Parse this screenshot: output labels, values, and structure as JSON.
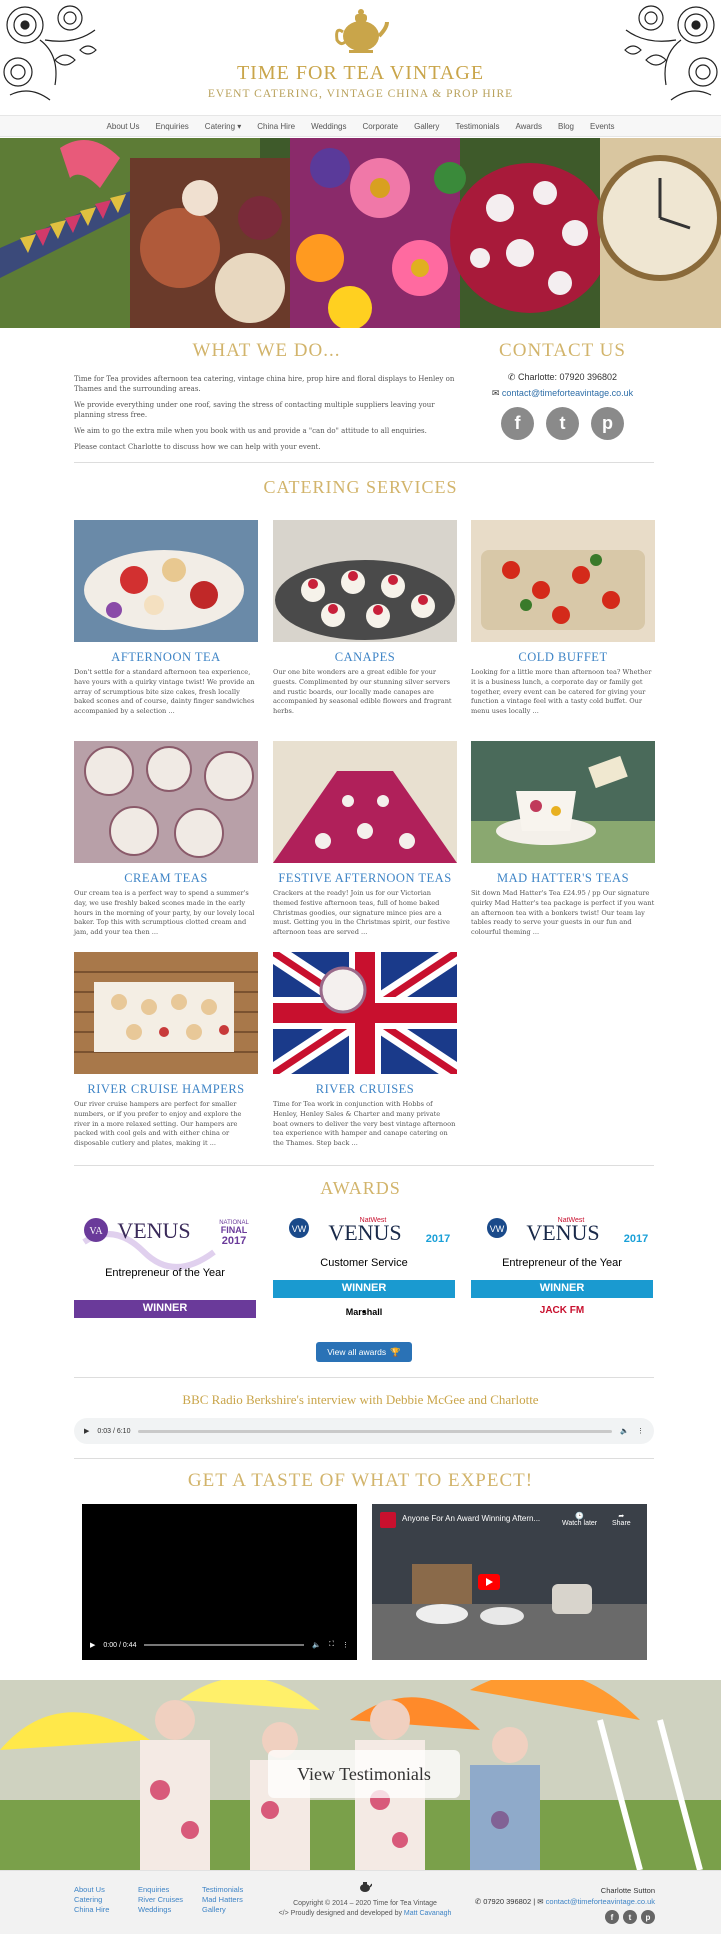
{
  "header": {
    "title": "TIME FOR TEA VINTAGE",
    "subtitle": "EVENT CATERING, VINTAGE CHINA & PROP HIRE"
  },
  "nav": {
    "items": [
      "About Us",
      "Enquiries",
      "Catering ▾",
      "China Hire",
      "Weddings",
      "Corporate",
      "Gallery",
      "Testimonials",
      "Awards",
      "Blog",
      "Events"
    ]
  },
  "what_we_do": {
    "heading": "WHAT WE DO...",
    "paragraphs": [
      "Time for Tea provides afternoon tea catering, vintage china hire, prop hire and floral displays to Henley on Thames and the surrounding areas.",
      "We provide everything under one roof, saving the stress of contacting multiple suppliers leaving your planning stress free.",
      "We aim to go the extra mile when you book with us and provide a \"can do\" attitude to all enquiries.",
      "Please contact Charlotte to discuss how we can help with your event."
    ]
  },
  "contact": {
    "heading": "CONTACT US",
    "phone": "Charlotte: 07920 396802",
    "email": "contact@timefortea​vintage.co.uk",
    "social": [
      "f",
      "t",
      "p"
    ]
  },
  "catering": {
    "heading": "CATERING SERVICES",
    "cards": [
      {
        "title": "AFTERNOON TEA",
        "text": "Don't settle for a standard afternoon tea experience, have yours with a quirky vintage twist! We provide an array of scrumptious bite size cakes, fresh locally baked scones and of course, dainty finger sandwiches accompanied by a selection ..."
      },
      {
        "title": "CANAPES",
        "text": "Our one bite wonders are a great edible for your guests. Complimented by our stunning silver servers and rustic boards, our locally made canapes are accompanied by seasonal edible flowers and fragrant herbs."
      },
      {
        "title": "COLD BUFFET",
        "text": "Looking for a little more than afternoon tea? Whether it is a business lunch, a corporate day or family get together, every event can be catered for giving your function a vintage feel with a tasty cold buffet. Our menu uses locally ..."
      },
      {
        "title": "CREAM TEAS",
        "text": "Our cream tea is a perfect way to spend a summer's day, we use freshly baked scones made in the early hours in the morning of your party, by our lovely local baker. Top this with scrumptious clotted cream and jam, add your tea then ..."
      },
      {
        "title": "FESTIVE AFTERNOON TEAS",
        "text": "Crackers at the ready! Join us for our Victorian themed festive afternoon teas, full of home baked Christmas goodies, our signature mince pies are a must. Getting you in the Christmas spirit, our festive afternoon teas are served ..."
      },
      {
        "title": "MAD HATTER'S TEAS",
        "text": "Sit down Mad Hatter's Tea £24.95 / pp Our signature quirky Mad Hatter's tea package is perfect if you want an afternoon tea with a bonkers twist! Our team lay tables ready to serve your guests in our fun and colourful theming ..."
      },
      {
        "title": "RIVER CRUISE HAMPERS",
        "text": "Our river cruise hampers are perfect for smaller numbers, or if you prefer to enjoy and explore the river in a more relaxed setting. Our hampers are packed with cool gels and with either china or disposable cutlery and plates, making it ..."
      },
      {
        "title": "RIVER CRUISES",
        "text": "Time for Tea work in conjunction with Hobbs of Henley, Henley Sales & Charter and many private boat owners to deliver the very best vintage afternoon tea experience with hamper and canape catering on the Thames. Step back ..."
      }
    ]
  },
  "awards": {
    "heading": "AWARDS",
    "items": [
      {
        "org": "VENUS",
        "badge": "NATIONAL FINAL 2017",
        "category": "Entrepreneur of the Year",
        "result": "WINNER",
        "sponsor": ""
      },
      {
        "org": "VENUS",
        "badge": "2017",
        "category": "Customer Service",
        "result": "WINNER",
        "sponsor": "Marshall"
      },
      {
        "org": "VENUS",
        "badge": "2017",
        "category": "Entrepreneur of the Year",
        "result": "WINNER",
        "sponsor": "JACK FM"
      }
    ],
    "button": "View all awards"
  },
  "radio": {
    "title": "BBC Radio Berkshire's interview with Debbie McGee and Charlotte",
    "time": "0:03 / 6:10"
  },
  "videos": {
    "heading": "GET A TASTE OF WHAT TO EXPECT!",
    "video1_time": "0:00 / 0:44",
    "video2_title": "Anyone For An Award Winning Aftern...",
    "watch_later": "Watch later",
    "share": "Share"
  },
  "testimonials": {
    "button": "View Testimonials"
  },
  "footer": {
    "col1": [
      "About Us",
      "Catering",
      "China Hire"
    ],
    "col2": [
      "Enquiries",
      "River Cruises",
      "Weddings"
    ],
    "col3": [
      "Testimonials",
      "Mad Hatters",
      "Gallery"
    ],
    "copyright": "Copyright © 2014 – 2020 Time for Tea Vintage",
    "credit_prefix": "Proudly designed and developed by",
    "credit_name": "Matt Cavanagh",
    "name": "Charlotte Sutton",
    "phone": "07920 396802",
    "email": "contact@timefortea​vintage.co.uk"
  },
  "colors": {
    "gold": "#c9a54a",
    "link": "#3e84c6",
    "button": "#2a72b6"
  }
}
